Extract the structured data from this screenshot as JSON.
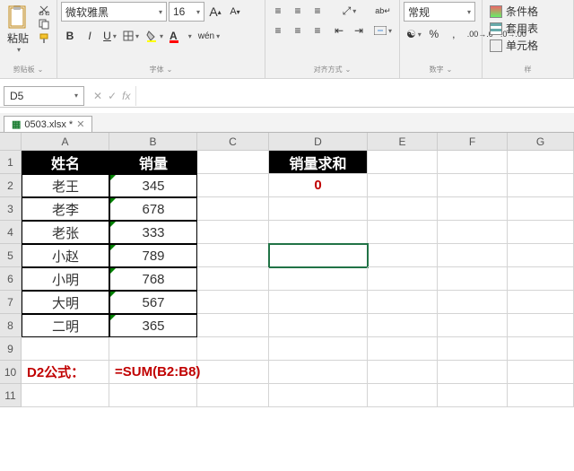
{
  "ribbon": {
    "clipboard": {
      "label": "剪贴板",
      "paste": "粘贴"
    },
    "font": {
      "label": "字体",
      "name": "微软雅黑",
      "size": "16",
      "bold": "B",
      "italic": "I",
      "underline": "U",
      "incA": "A",
      "decA": "A",
      "wen": "wén"
    },
    "align": {
      "label": "对齐方式"
    },
    "number": {
      "label": "数字",
      "format": "常规"
    },
    "styles": {
      "label": "样",
      "cond": "条件格",
      "table": "套用表",
      "cell": "单元格"
    }
  },
  "namebox": "D5",
  "fx": "fx",
  "tab": {
    "file": "0503.xlsx *"
  },
  "cols": [
    "",
    "A",
    "B",
    "C",
    "D",
    "E",
    "F",
    "G"
  ],
  "rows": [
    "1",
    "2",
    "3",
    "4",
    "5",
    "6",
    "7",
    "8",
    "9",
    "10",
    "11"
  ],
  "headers": {
    "a": "姓名",
    "b": "销量",
    "d": "销量求和"
  },
  "data": [
    {
      "name": "老王",
      "val": "345"
    },
    {
      "name": "老李",
      "val": "678"
    },
    {
      "name": "老张",
      "val": "333"
    },
    {
      "name": "小赵",
      "val": "789"
    },
    {
      "name": "小明",
      "val": "768"
    },
    {
      "name": "大明",
      "val": "567"
    },
    {
      "name": "二明",
      "val": "365"
    }
  ],
  "sumResult": "0",
  "note": {
    "label": "D2公式：",
    "formula": "=SUM(B2:B8)"
  }
}
